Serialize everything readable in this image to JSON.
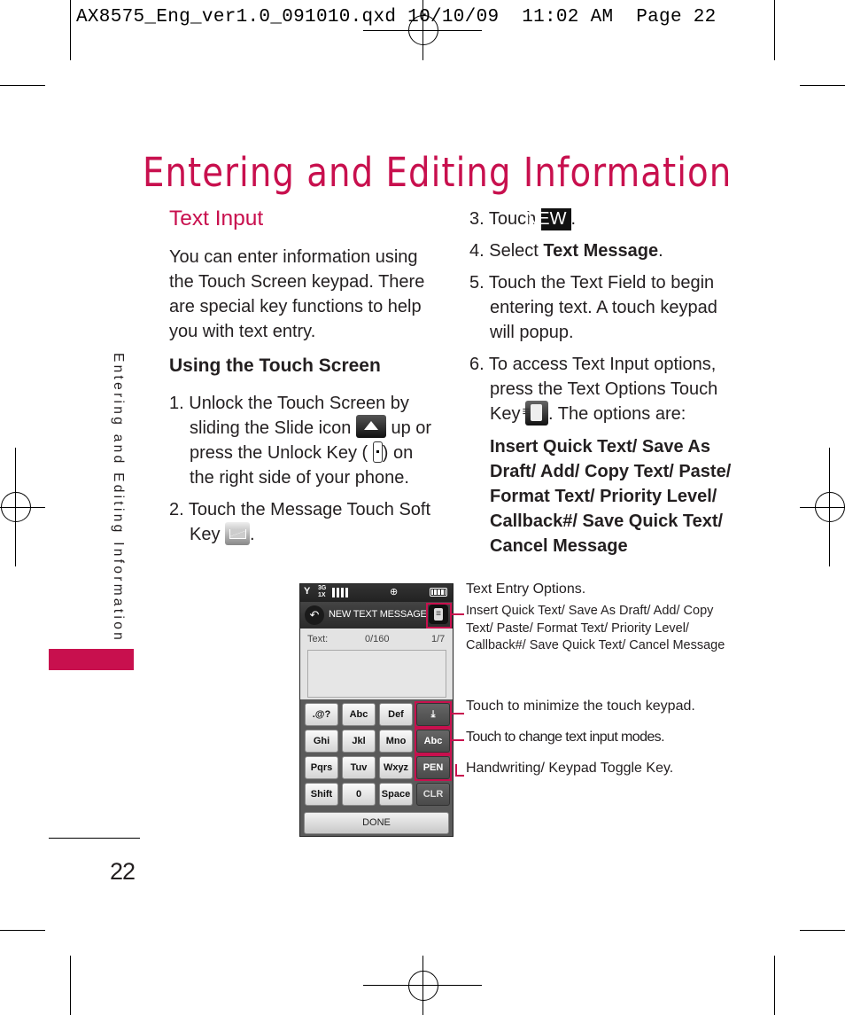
{
  "slug": {
    "filename": "AX8575_Eng_ver1.0_091010.qxd",
    "date": "10/10/09",
    "time": "11:02 AM",
    "page_label": "Page 22"
  },
  "page": {
    "title": "Entering and Editing Information",
    "side_tab": "Entering and Editing Information",
    "page_number": "22",
    "accent_color": "#c8104e"
  },
  "left_column": {
    "heading": "Text Input",
    "intro": "You can enter information using the Touch Screen keypad. There are special key functions to help you with text entry.",
    "subheading": "Using the Touch Screen",
    "steps": [
      {
        "num": "1.",
        "before": "Unlock the Touch Screen by sliding the Slide icon",
        "middle": "up or press the Unlock Key (",
        "after": ") on the right side of your phone."
      },
      {
        "num": "2.",
        "before": "Touch the Message Touch Soft Key",
        "after": "."
      }
    ]
  },
  "right_column": {
    "steps": [
      {
        "num": "3.",
        "before": "Touch",
        "badge": "NEW",
        "after": "."
      },
      {
        "num": "4.",
        "before": "Select",
        "bold": "Text Message",
        "after": "."
      },
      {
        "num": "5.",
        "text": "Touch the Text Field to begin entering text. A touch keypad will popup."
      },
      {
        "num": "6.",
        "before": "To access Text Input options, press the Text Options Touch Key",
        "after": ". The options are:"
      }
    ],
    "options_list": "Insert Quick Text/ Save As Draft/ Add/ Copy Text/ Paste/ Format Text/ Priority Level/ Callback#/ Save Quick Text/ Cancel Message"
  },
  "phone": {
    "status": {
      "signal": "Y",
      "network_top": "3G",
      "network_bottom": "1X",
      "center_icon": "⊕"
    },
    "title": "NEW TEXT MESSAGE",
    "text_label": "Text:",
    "char_count": "0/160",
    "page_count": "1/7",
    "keys": [
      [
        ".@?",
        "Abc",
        "Def",
        "⤓"
      ],
      [
        "Ghi",
        "Jkl",
        "Mno",
        "Abc"
      ],
      [
        "Pqrs",
        "Tuv",
        "Wxyz",
        "PEN"
      ],
      [
        "Shift",
        "0",
        "Space",
        "CLR"
      ]
    ],
    "done": "DONE"
  },
  "callouts": {
    "options_title": "Text Entry Options.",
    "options_detail": "Insert Quick Text/ Save As Draft/ Add/ Copy Text/ Paste/ Format Text/ Priority Level/ Callback#/ Save Quick Text/ Cancel Message",
    "minimize": "Touch to minimize the touch keypad.",
    "mode": "Touch to change text input modes.",
    "toggle": "Handwriting/ Keypad Toggle Key."
  }
}
